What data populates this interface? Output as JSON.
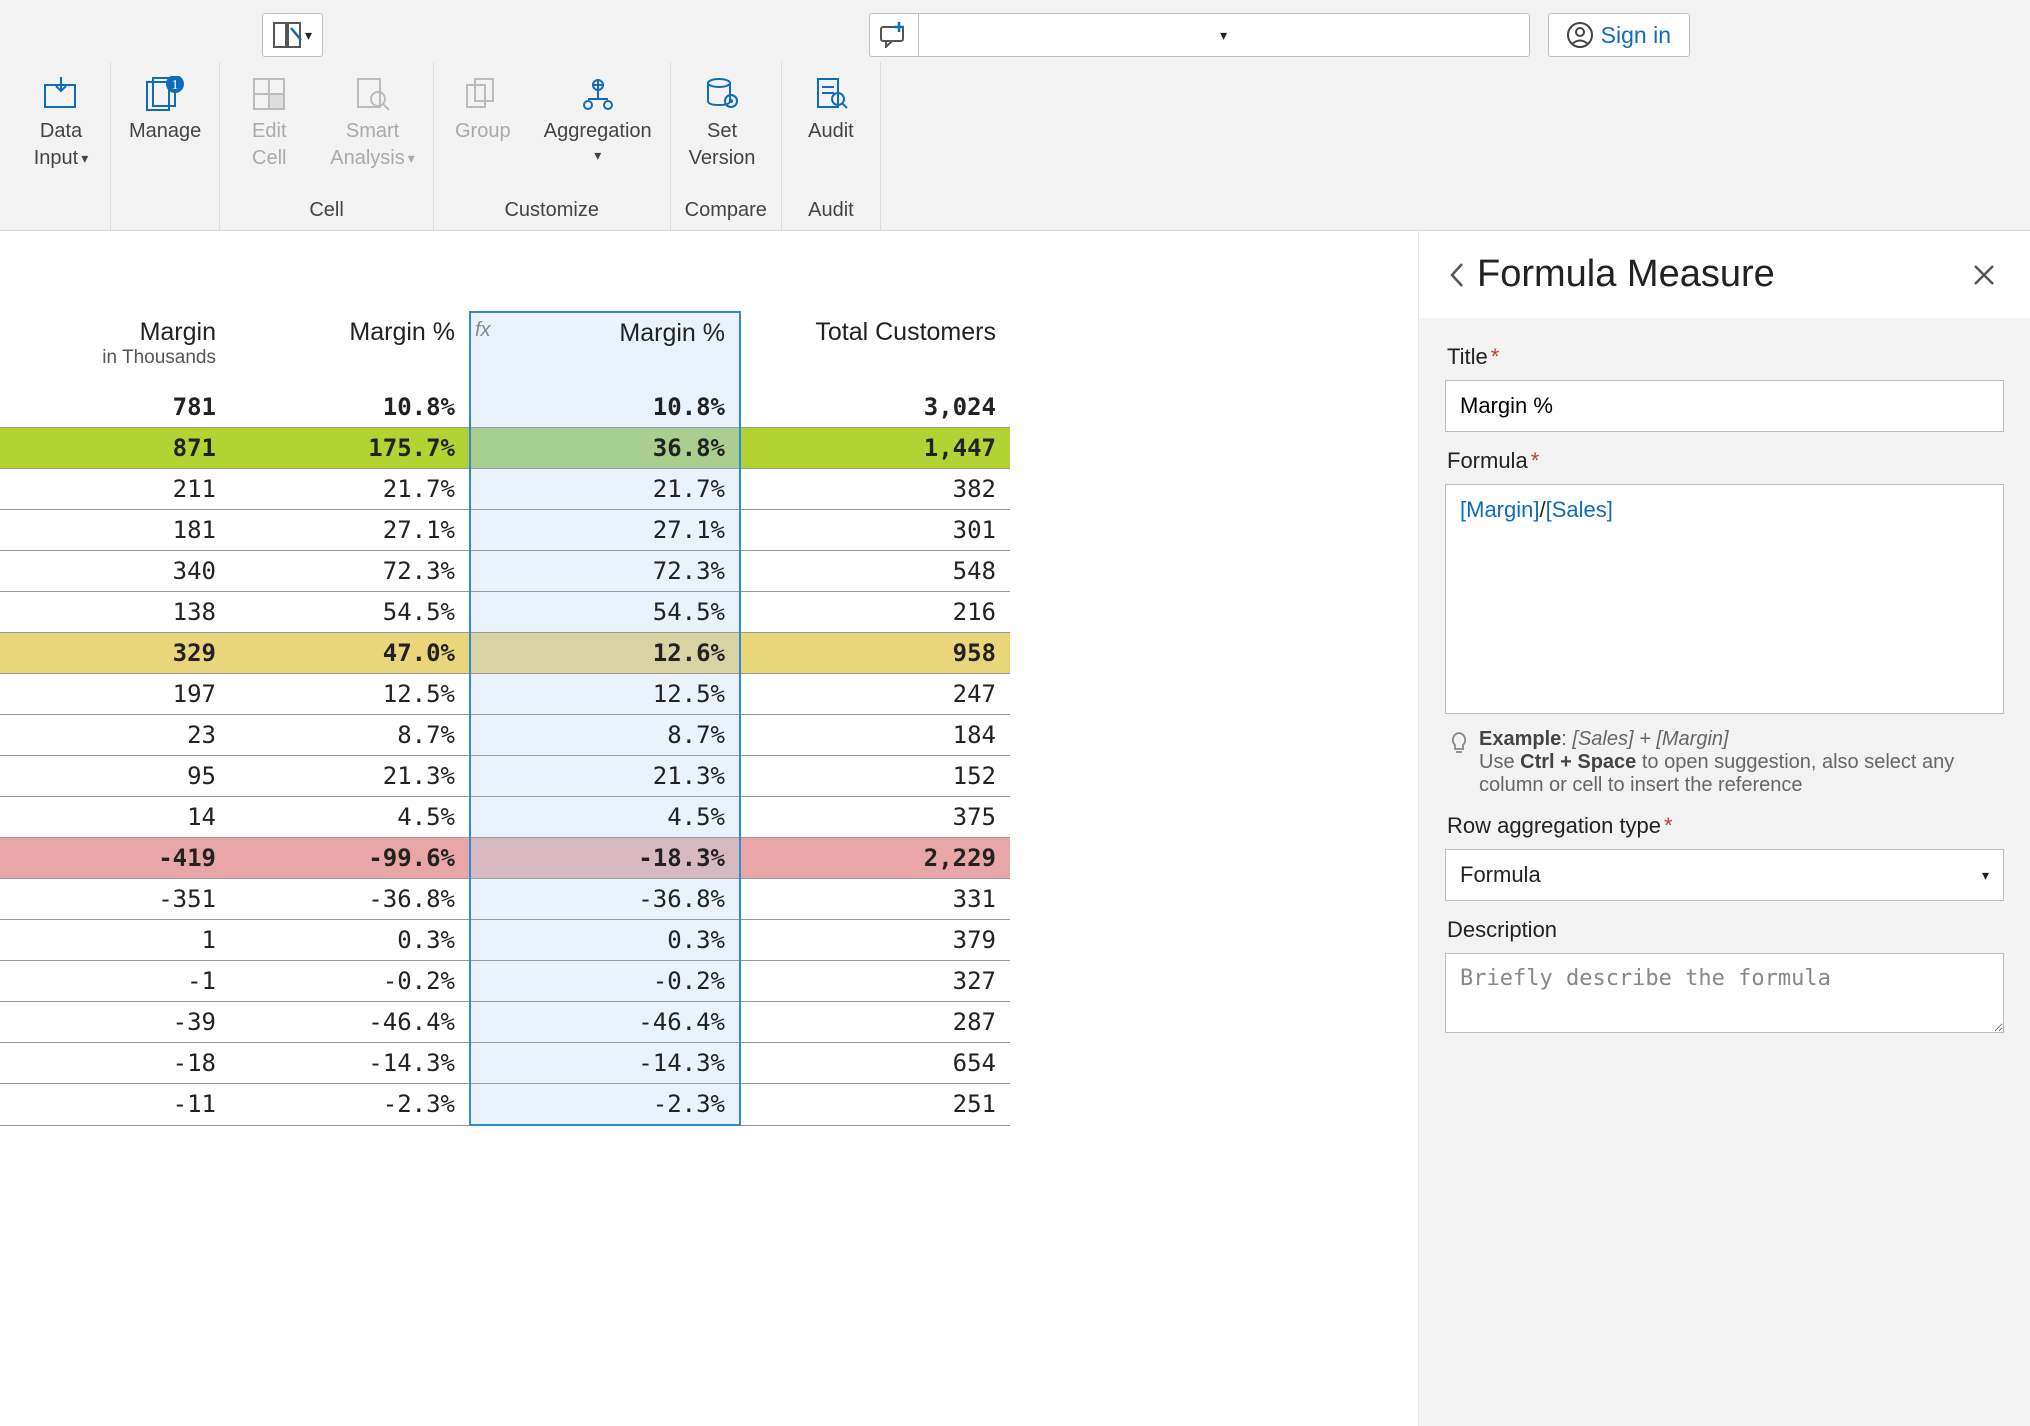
{
  "topbar": {
    "signin": "Sign in"
  },
  "ribbon": {
    "dataInput": {
      "line1": "Data",
      "line2": "Input"
    },
    "manage": "Manage",
    "editCell": {
      "line1": "Edit",
      "line2": "Cell"
    },
    "smartAnalysis": {
      "line1": "Smart",
      "line2": "Analysis"
    },
    "groupCell": "Cell",
    "groupBtn": "Group",
    "aggregation": "Aggregation",
    "groupCustomize": "Customize",
    "setVersion": {
      "line1": "Set",
      "line2": "Version"
    },
    "groupCompare": "Compare",
    "audit": "Audit",
    "groupAudit": "Audit"
  },
  "table": {
    "headers": {
      "margin": "Margin",
      "marginSub": "in Thousands",
      "marginPct1": "Margin %",
      "marginPct2": "Margin %",
      "totalCustomers": "Total Customers",
      "fx": "fx"
    },
    "rows": [
      {
        "style": "bold",
        "c1": "781",
        "c2": "10.8%",
        "c3": "10.8%",
        "c4": "3,024"
      },
      {
        "style": "green bold",
        "c1": "871",
        "c2": "175.7%",
        "c3": "36.8%",
        "c4": "1,447"
      },
      {
        "style": "",
        "c1": "211",
        "c2": "21.7%",
        "c3": "21.7%",
        "c4": "382"
      },
      {
        "style": "",
        "c1": "181",
        "c2": "27.1%",
        "c3": "27.1%",
        "c4": "301"
      },
      {
        "style": "",
        "c1": "340",
        "c2": "72.3%",
        "c3": "72.3%",
        "c4": "548"
      },
      {
        "style": "",
        "c1": "138",
        "c2": "54.5%",
        "c3": "54.5%",
        "c4": "216"
      },
      {
        "style": "yellow bold",
        "c1": "329",
        "c2": "47.0%",
        "c3": "12.6%",
        "c4": "958"
      },
      {
        "style": "",
        "c1": "197",
        "c2": "12.5%",
        "c3": "12.5%",
        "c4": "247"
      },
      {
        "style": "",
        "c1": "23",
        "c2": "8.7%",
        "c3": "8.7%",
        "c4": "184"
      },
      {
        "style": "",
        "c1": "95",
        "c2": "21.3%",
        "c3": "21.3%",
        "c4": "152"
      },
      {
        "style": "",
        "c1": "14",
        "c2": "4.5%",
        "c3": "4.5%",
        "c4": "375"
      },
      {
        "style": "pink bold",
        "c1": "-419",
        "c2": "-99.6%",
        "c3": "-18.3%",
        "c4": "2,229"
      },
      {
        "style": "",
        "c1": "-351",
        "c2": "-36.8%",
        "c3": "-36.8%",
        "c4": "331"
      },
      {
        "style": "",
        "c1": "1",
        "c2": "0.3%",
        "c3": "0.3%",
        "c4": "379"
      },
      {
        "style": "",
        "c1": "-1",
        "c2": "-0.2%",
        "c3": "-0.2%",
        "c4": "327"
      },
      {
        "style": "",
        "c1": "-39",
        "c2": "-46.4%",
        "c3": "-46.4%",
        "c4": "287"
      },
      {
        "style": "",
        "c1": "-18",
        "c2": "-14.3%",
        "c3": "-14.3%",
        "c4": "654"
      },
      {
        "style": "",
        "c1": "-11",
        "c2": "-2.3%",
        "c3": "-2.3%",
        "c4": "251"
      }
    ]
  },
  "panel": {
    "title": "Formula Measure",
    "titleLabel": "Title",
    "titleValue": "Margin %",
    "formulaLabel": "Formula",
    "formulaTok1": "[Margin]",
    "formulaSep": "/",
    "formulaTok2": "[Sales]",
    "exampleWord": "Example",
    "exampleExpr": "[Sales] + [Margin]",
    "hintLine1a": "Use ",
    "hintLine1b": "Ctrl + Space",
    "hintLine1c": " to open suggestion, also select any column or cell to insert the reference",
    "rowAggLabel": "Row aggregation type",
    "rowAggValue": "Formula",
    "descLabel": "Description",
    "descPlaceholder": "Briefly describe the formula"
  }
}
